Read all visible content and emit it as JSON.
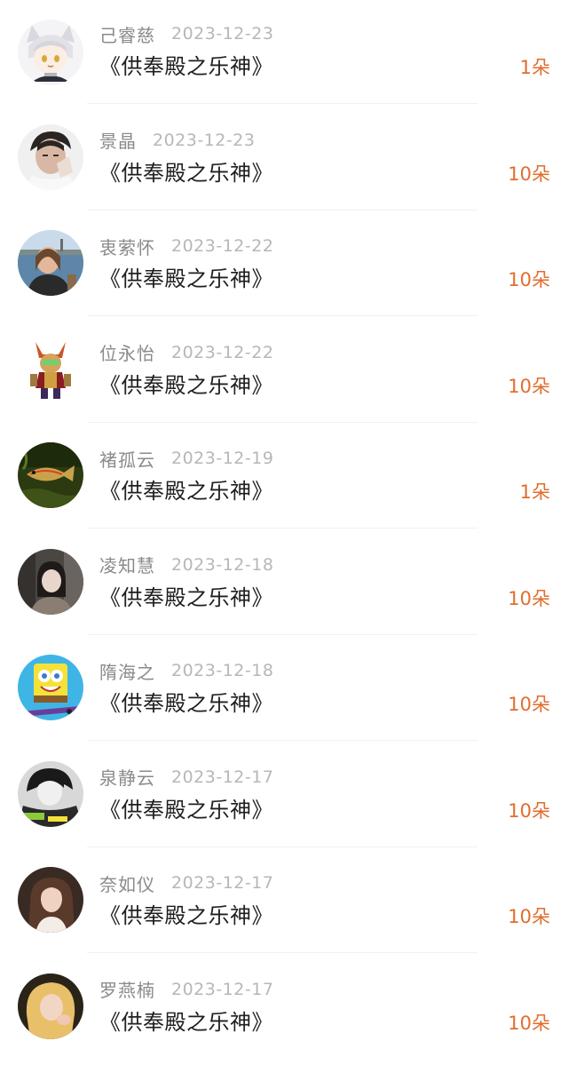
{
  "items": [
    {
      "name": "己睿慈",
      "date": "2023-12-23",
      "title": "《供奉殿之乐神》",
      "gift": "1朵",
      "avatar_icon": "anime-cat-boy-avatar"
    },
    {
      "name": "景晶",
      "date": "2023-12-23",
      "title": "《供奉殿之乐神》",
      "gift": "10朵",
      "avatar_icon": "man-portrait-avatar"
    },
    {
      "name": "衷萦怀",
      "date": "2023-12-22",
      "title": "《供奉殿之乐神》",
      "gift": "10朵",
      "avatar_icon": "woman-lakeside-avatar"
    },
    {
      "name": "位永怡",
      "date": "2023-12-22",
      "title": "《供奉殿之乐神》",
      "gift": "10朵",
      "avatar_icon": "game-hero-character-avatar"
    },
    {
      "name": "褚孤云",
      "date": "2023-12-19",
      "title": "《供奉殿之乐神》",
      "gift": "1朵",
      "avatar_icon": "fish-avatar"
    },
    {
      "name": "凌知慧",
      "date": "2023-12-18",
      "title": "《供奉殿之乐神》",
      "gift": "10朵",
      "avatar_icon": "woman-dark-portrait-avatar"
    },
    {
      "name": "隋海之",
      "date": "2023-12-18",
      "title": "《供奉殿之乐神》",
      "gift": "10朵",
      "avatar_icon": "cartoon-sponge-avatar"
    },
    {
      "name": "泉静云",
      "date": "2023-12-17",
      "title": "《供奉殿之乐神》",
      "gift": "10朵",
      "avatar_icon": "black-white-portrait-avatar"
    },
    {
      "name": "奈如仪",
      "date": "2023-12-17",
      "title": "《供奉殿之乐神》",
      "gift": "10朵",
      "avatar_icon": "woman-portrait-avatar"
    },
    {
      "name": "罗燕楠",
      "date": "2023-12-17",
      "title": "《供奉殿之乐神》",
      "gift": "10朵",
      "avatar_icon": "blonde-portrait-avatar"
    }
  ],
  "colors": {
    "gift": "#e06d2d",
    "name": "#8a8a8a",
    "date": "#b7b7b7",
    "title": "#1f1f1f"
  }
}
